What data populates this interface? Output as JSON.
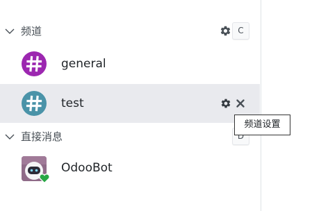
{
  "channels": {
    "header_label": "频道",
    "key_hint": "C",
    "items": [
      {
        "name": "general",
        "avatar_symbol": "#",
        "avatar_color": "#9c27b0"
      },
      {
        "name": "test",
        "avatar_symbol": "#",
        "avatar_color": "#4a93a8"
      }
    ]
  },
  "direct_messages": {
    "header_label": "直接消息",
    "key_hint": "D",
    "items": [
      {
        "name": "OdooBot",
        "presence": "online"
      }
    ]
  },
  "tooltip": {
    "text": "频道设置"
  },
  "colors": {
    "active_row": "#e9eaee",
    "icon_gray": "#495057",
    "presence_green": "#28a745"
  },
  "icons": {
    "category_toggle": "chevron-down-icon",
    "channel_settings": "gear-icon",
    "leave_channel": "close-icon"
  }
}
